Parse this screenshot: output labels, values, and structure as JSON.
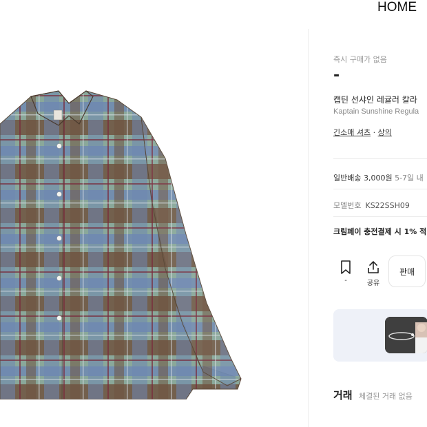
{
  "header": {
    "home_label": "HOME"
  },
  "product": {
    "status": "즉시 구매가 없음",
    "price": "-",
    "title_ko": "캡틴 선샤인 레귤러 칼라",
    "title_en": "Kaptain Sunshine Regula",
    "category_1": "긴소매 셔츠",
    "category_sep": " · ",
    "category_2": "상의"
  },
  "details": {
    "delivery_label": "일반배송 3,000원",
    "delivery_note": " 5-7일 내",
    "model_label": "모델번호",
    "model_value": "KS22SSH09",
    "promo": "크림페이 충전결제 시 1% ",
    "promo_tail": "적"
  },
  "actions": {
    "bookmark_count": "-",
    "share_label": "공유",
    "sell_label": "판매"
  },
  "trade": {
    "title": "거래",
    "subtitle": "체결된 거래 없음"
  },
  "colors": {
    "accent_bg": "#eef1f8",
    "plaid_blue": "#6d87b3",
    "plaid_green": "#8aa89a",
    "plaid_brown": "#6e5340"
  }
}
